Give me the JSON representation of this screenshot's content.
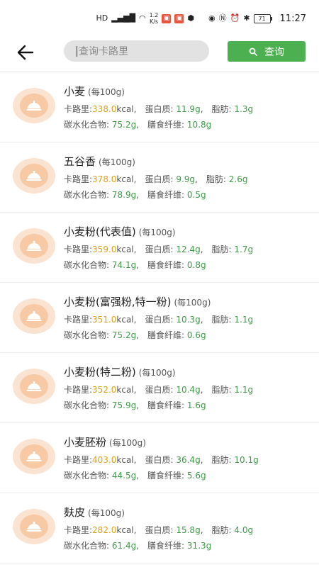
{
  "status_bar": {
    "speed_top": "1.2",
    "speed_bottom": "K/s",
    "battery": "71",
    "time": "11:27"
  },
  "search": {
    "placeholder": "查询卡路里",
    "button_label": "查询"
  },
  "labels": {
    "calories": "卡路里:",
    "protein": "蛋白质:",
    "fat": "脂肪:",
    "carbs": "碳水化合物:",
    "fiber": "膳食纤维:"
  },
  "foods": [
    {
      "name": "小麦",
      "unit": "(每100g)",
      "cal": "338.0",
      "cal_unit": "kcal",
      "protein": "11.9g",
      "fat": "1.3g",
      "carbs": "75.2g",
      "fiber": "10.8g"
    },
    {
      "name": "五谷香",
      "unit": "(每100g)",
      "cal": "378.0",
      "cal_unit": "kcal",
      "protein": "9.9g",
      "fat": "2.6g",
      "carbs": "78.9g",
      "fiber": "0.5g"
    },
    {
      "name": "小麦粉(代表值)",
      "unit": "(每100g)",
      "cal": "359.0",
      "cal_unit": "kcal",
      "protein": "12.4g",
      "fat": "1.7g",
      "carbs": "74.1g",
      "fiber": "0.8g"
    },
    {
      "name": "小麦粉(富强粉,特一粉)",
      "unit": "(每100g)",
      "cal": "351.0",
      "cal_unit": "kcal",
      "protein": "10.3g",
      "fat": "1.1g",
      "carbs": "75.2g",
      "fiber": "0.6g"
    },
    {
      "name": "小麦粉(特二粉)",
      "unit": "(每100g)",
      "cal": "352.0",
      "cal_unit": "kcal",
      "protein": "10.4g",
      "fat": "1.1g",
      "carbs": "75.9g",
      "fiber": "1.6g"
    },
    {
      "name": "小麦胚粉",
      "unit": "(每100g)",
      "cal": "403.0",
      "cal_unit": "kcal",
      "protein": "36.4g",
      "fat": "10.1g",
      "carbs": "44.5g",
      "fiber": "5.6g"
    },
    {
      "name": "麸皮",
      "unit": "(每100g)",
      "cal": "282.0",
      "cal_unit": "kcal",
      "protein": "15.8g",
      "fat": "4.0g",
      "carbs": "61.4g",
      "fiber": "31.3g"
    }
  ],
  "colors": {
    "accent": "#4caf50",
    "calorie": "#e0a216",
    "nutrient": "#3f9b47",
    "avatar": "#fbe3d2"
  }
}
